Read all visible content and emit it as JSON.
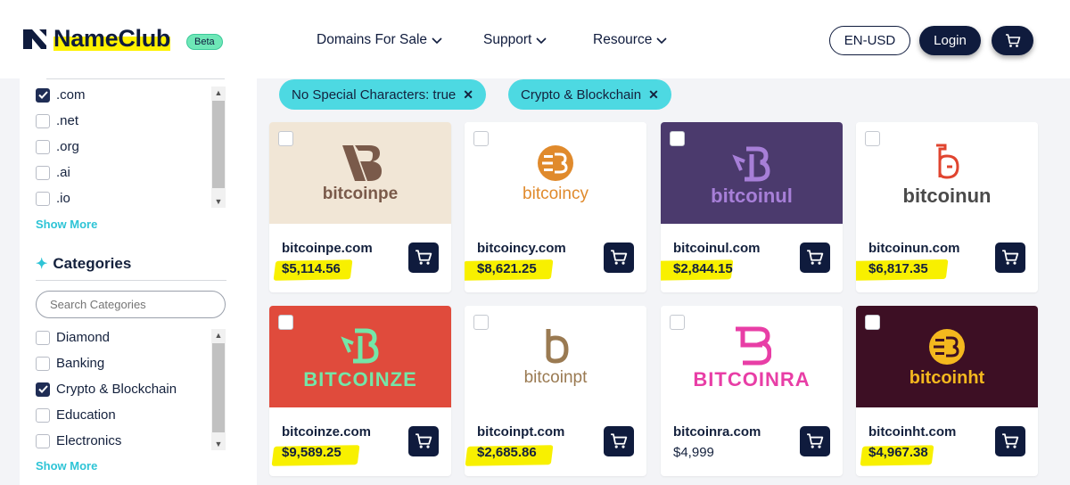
{
  "header": {
    "logo_text": "NameClub",
    "beta_label": "Beta",
    "nav": [
      "Domains For Sale",
      "Support",
      "Resource"
    ],
    "lang_label": "EN-USD",
    "login_label": "Login"
  },
  "sidebar": {
    "extensions": [
      {
        "label": ".com",
        "checked": true
      },
      {
        "label": ".net",
        "checked": false
      },
      {
        "label": ".org",
        "checked": false
      },
      {
        "label": ".ai",
        "checked": false
      },
      {
        "label": ".io",
        "checked": false
      }
    ],
    "show_more": "Show More",
    "categories_title": "Categories",
    "search_placeholder": "Search Categories",
    "categories": [
      {
        "label": "Diamond",
        "checked": false
      },
      {
        "label": "Banking",
        "checked": false
      },
      {
        "label": "Crypto & Blockchain",
        "checked": true
      },
      {
        "label": "Education",
        "checked": false
      },
      {
        "label": "Electronics",
        "checked": false
      }
    ]
  },
  "filters": [
    "No Special Characters: true",
    "Crypto & Blockchain"
  ],
  "cards": [
    {
      "domain": "bitcoinpe.com",
      "price": "$5,114.56",
      "brand": "bitcoinpe",
      "bg": "#f1e6d6",
      "highlighted": true
    },
    {
      "domain": "bitcoincy.com",
      "price": "$8,621.25",
      "brand": "bitcoincy",
      "bg": "#ffffff",
      "highlighted": true
    },
    {
      "domain": "bitcoinul.com",
      "price": "$2,844.15",
      "brand": "bitcoinul",
      "bg": "#4b3a6d",
      "highlighted": true
    },
    {
      "domain": "bitcoinun.com",
      "price": "$6,817.35",
      "brand": "bitcoinun",
      "bg": "#ffffff",
      "highlighted": true
    },
    {
      "domain": "bitcoinze.com",
      "price": "$9,589.25",
      "brand": "BITCOINZE",
      "bg": "#e04b3c",
      "highlighted": true
    },
    {
      "domain": "bitcoinpt.com",
      "price": "$2,685.86",
      "brand": "bitcoinpt",
      "bg": "#ffffff",
      "highlighted": true
    },
    {
      "domain": "bitcoinra.com",
      "price": "$4,999",
      "brand": "BITCOINRA",
      "bg": "#ffffff",
      "highlighted": false
    },
    {
      "domain": "bitcoinht.com",
      "price": "$4,967.38",
      "brand": "bitcoinht",
      "bg": "#3d0f24",
      "highlighted": true
    }
  ],
  "colors": {
    "navy": "#0f1b3d",
    "teal": "#4dd9e2",
    "highlight": "#f8f000"
  }
}
